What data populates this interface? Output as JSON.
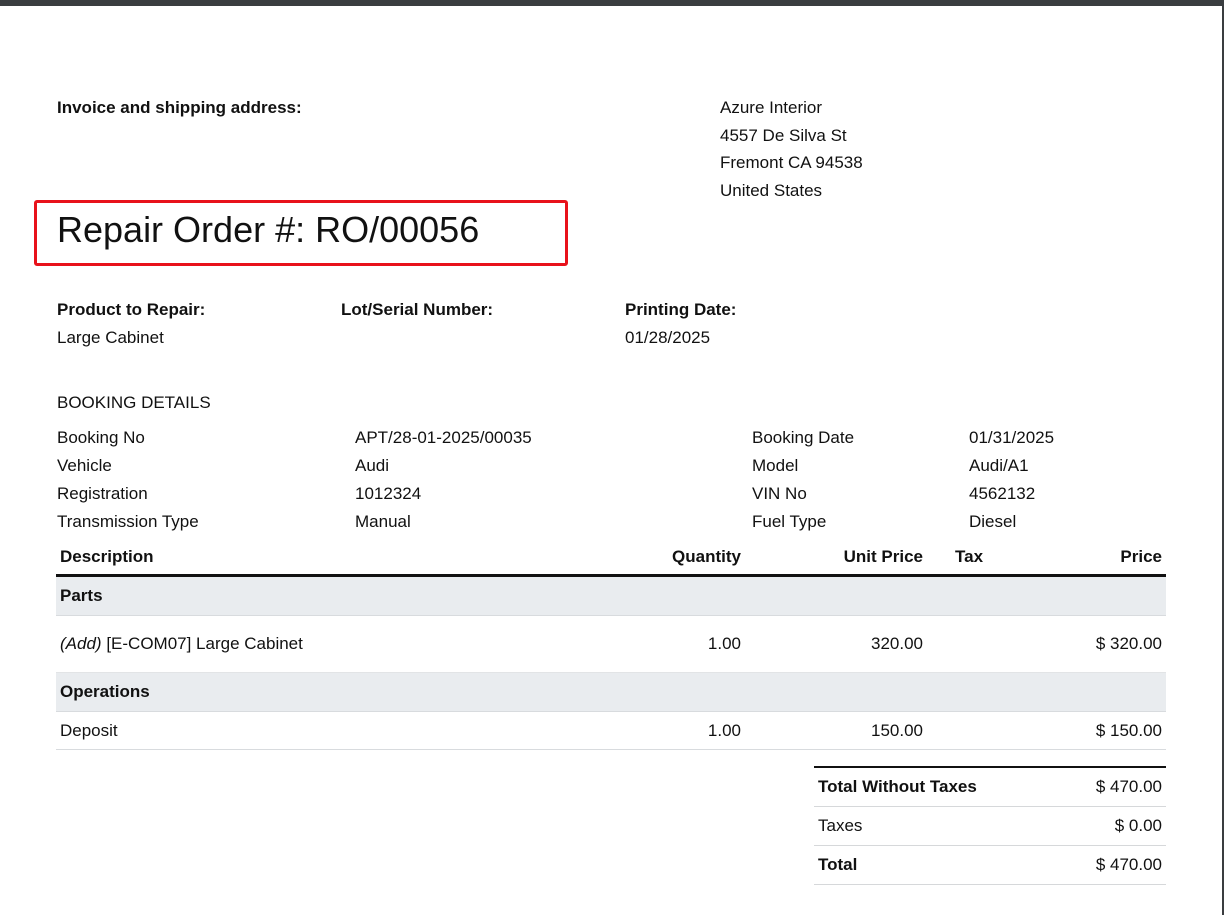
{
  "header": {
    "address_label": "Invoice and shipping address:",
    "address": [
      "Azure Interior",
      "4557 De Silva St",
      "Fremont CA 94538",
      "United States"
    ]
  },
  "title": "Repair Order #: RO/00056",
  "info": {
    "product_label": "Product to Repair:",
    "product_value": "Large Cabinet",
    "lot_label": "Lot/Serial Number:",
    "lot_value": "",
    "printing_date_label": "Printing Date:",
    "printing_date_value": "01/28/2025"
  },
  "booking": {
    "heading": "BOOKING DETAILS",
    "rows": [
      {
        "l1": "Booking No",
        "v1": "APT/28-01-2025/00035",
        "l2": "Booking Date",
        "v2": "01/31/2025"
      },
      {
        "l1": "Vehicle",
        "v1": "Audi",
        "l2": "Model",
        "v2": "Audi/A1"
      },
      {
        "l1": "Registration",
        "v1": "1012324",
        "l2": "VIN No",
        "v2": "4562132"
      },
      {
        "l1": "Transmission Type",
        "v1": "Manual",
        "l2": "Fuel Type",
        "v2": "Diesel"
      }
    ]
  },
  "table": {
    "headers": {
      "description": "Description",
      "quantity": "Quantity",
      "unit_price": "Unit Price",
      "tax": "Tax",
      "price": "Price"
    },
    "sections": [
      {
        "name": "Parts",
        "lines": [
          {
            "prefix": "(Add)",
            "description": "[E-COM07] Large Cabinet",
            "quantity": "1.00",
            "unit_price": "320.00",
            "tax": "",
            "price": "$ 320.00"
          }
        ]
      },
      {
        "name": "Operations",
        "lines": [
          {
            "prefix": "",
            "description": "Deposit",
            "quantity": "1.00",
            "unit_price": "150.00",
            "tax": "",
            "price": "$ 150.00"
          }
        ]
      }
    ]
  },
  "totals": {
    "subtotal_label": "Total Without Taxes",
    "subtotal_value": "$ 470.00",
    "taxes_label": "Taxes",
    "taxes_value": "$ 0.00",
    "total_label": "Total",
    "total_value": "$ 470.00"
  }
}
